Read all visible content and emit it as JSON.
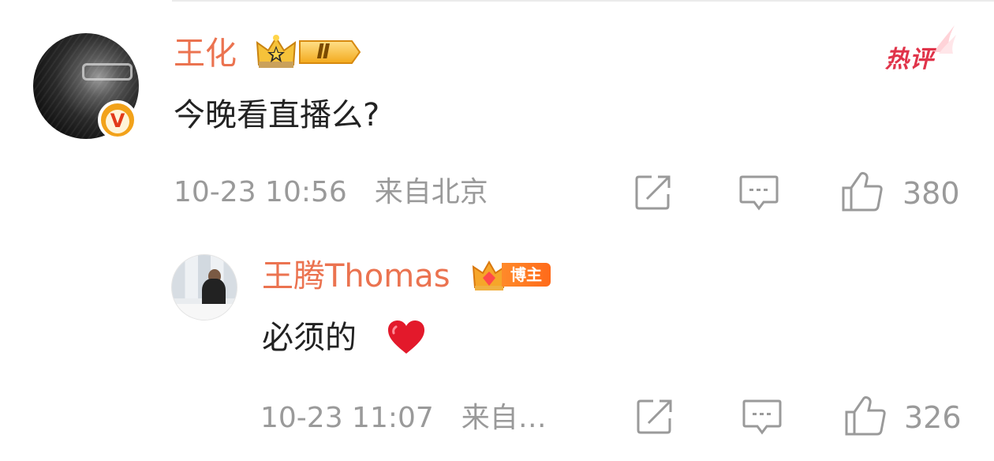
{
  "comment": {
    "username": "王化",
    "level_badge": "Ⅱ",
    "hot_tag": "热评",
    "text": "今晚看直播么?",
    "time": "10-23 10:56",
    "location": "来自北京",
    "likes": "380",
    "icons": {
      "verified": "verified-v-icon",
      "forward": "forward-icon",
      "reply": "comment-icon",
      "like": "thumbs-up-icon"
    }
  },
  "reply": {
    "username": "王腾Thomas",
    "badge_label": "博主",
    "text": "必须的",
    "emoji": "heart-emoji",
    "time": "10-23 11:07",
    "location": "来自…",
    "likes": "326"
  },
  "colors": {
    "username": "#eb7350",
    "text": "#222222",
    "meta": "#9a9a9a",
    "hot": "#e0344a",
    "badge": "#f2a21a"
  }
}
